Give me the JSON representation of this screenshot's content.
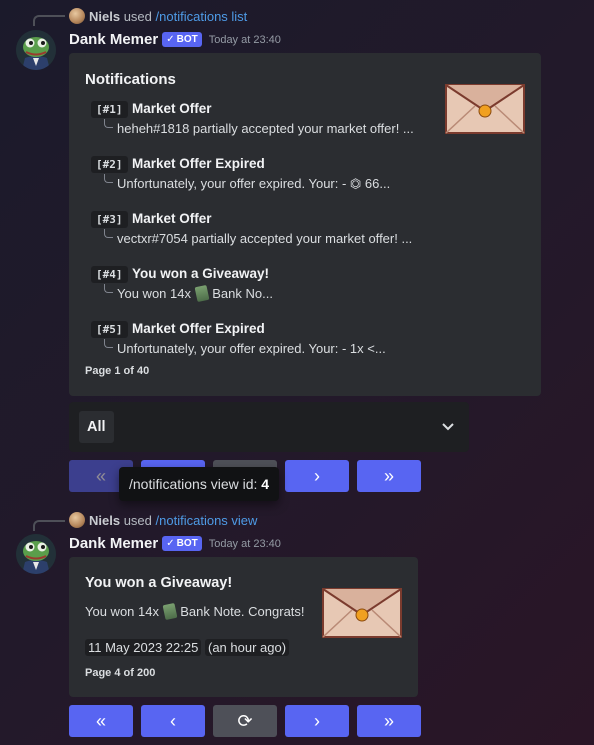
{
  "messages": [
    {
      "reply": {
        "user": "Niels",
        "used": "used",
        "command": "/notifications list"
      },
      "author": "Dank Memer",
      "bot_tag": "BOT",
      "timestamp": "Today at 23:40",
      "embed": {
        "title": "Notifications",
        "items": [
          {
            "num": "[#1]",
            "title": "Market Offer",
            "desc": "heheh#1818 partially accepted your market offer! ..."
          },
          {
            "num": "[#2]",
            "title": "Market Offer Expired",
            "desc": "Unfortunately, your offer expired. Your: - ⏣ 66..."
          },
          {
            "num": "[#3]",
            "title": "Market Offer",
            "desc": "vectxr#7054 partially accepted your market offer! ..."
          },
          {
            "num": "[#4]",
            "title": "You won a Giveaway!",
            "desc_pre": "You won 14x",
            "desc_post": "Bank No..."
          },
          {
            "num": "[#5]",
            "title": "Market Offer Expired",
            "desc": "Unfortunately, your offer expired. Your: - 1x <..."
          }
        ],
        "footer": "Page 1 of 40",
        "thumbnail_icon": "envelope-icon"
      },
      "select": {
        "value": "All",
        "icon": "chevron-down-icon"
      },
      "buttons": [
        "«",
        "‹",
        "⟳",
        "›",
        "»"
      ]
    },
    {
      "reply": {
        "user": "Niels",
        "used": "used",
        "command": "/notifications view"
      },
      "author": "Dank Memer",
      "bot_tag": "BOT",
      "timestamp": "Today at 23:40",
      "embed": {
        "title": "You won a Giveaway!",
        "desc_pre": "You won 14x",
        "desc_post": "Bank Note. Congrats!",
        "date": "11 May 2023 22:25",
        "relative": "an hour ago",
        "footer": "Page 4 of 200",
        "thumbnail_icon": "envelope-icon"
      },
      "buttons": [
        "«",
        "‹",
        "⟳",
        "›",
        "»"
      ]
    }
  ],
  "tooltip": {
    "text": "/notifications view id:",
    "id": "4"
  },
  "colors": {
    "blurple": "#5865f2",
    "embed_bg": "#2b2d31",
    "grey_button": "#4e5058",
    "link": "#4e9be6"
  }
}
